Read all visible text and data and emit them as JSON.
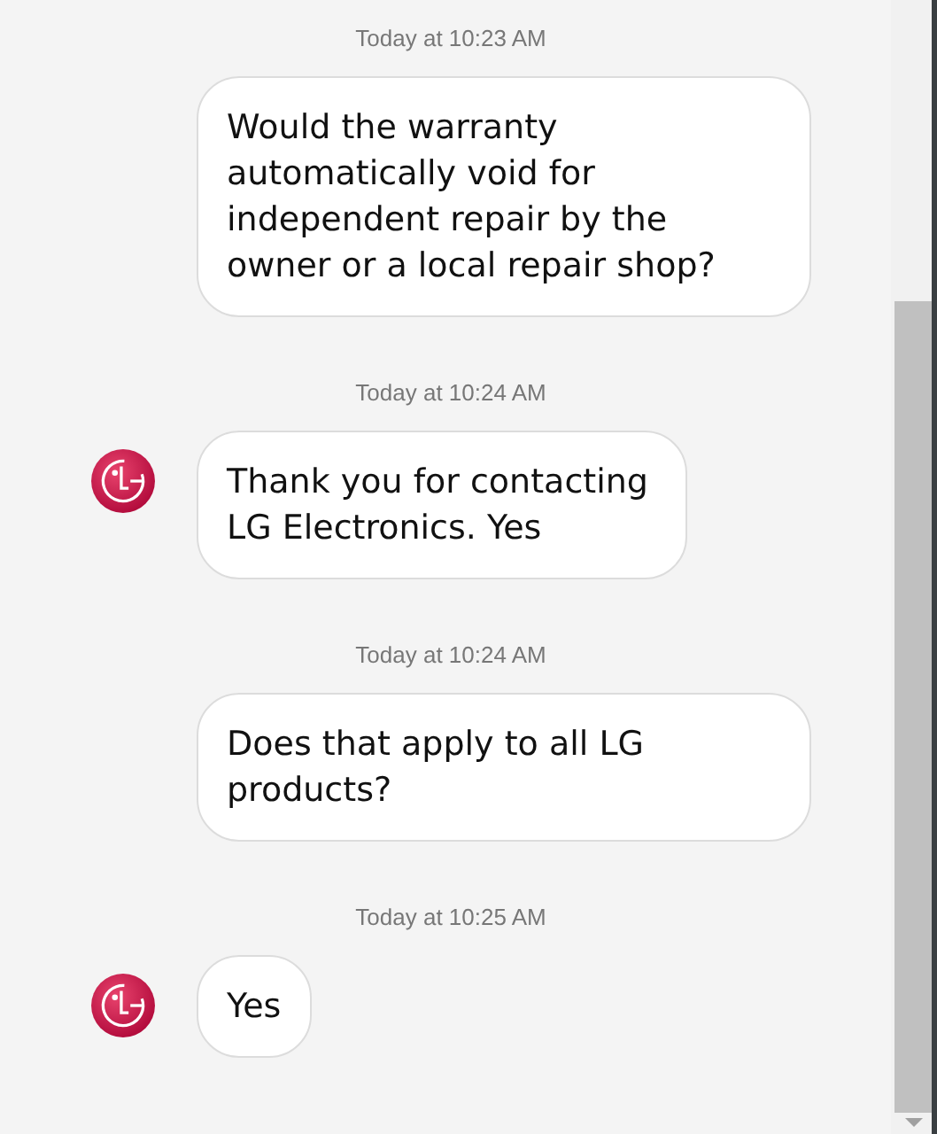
{
  "messages": [
    {
      "timestamp": "Today at 10:23 AM",
      "kind": "user",
      "text": "Would the warranty automatically void for independent repair by the owner or a local repair shop?"
    },
    {
      "timestamp": "Today at 10:24 AM",
      "kind": "agent",
      "text": "Thank you for contacting LG Electronics. Yes"
    },
    {
      "timestamp": "Today at 10:24 AM",
      "kind": "user",
      "text": "Does that apply to all LG products?"
    },
    {
      "timestamp": "Today at 10:25 AM",
      "kind": "agent",
      "text": "Yes"
    }
  ]
}
